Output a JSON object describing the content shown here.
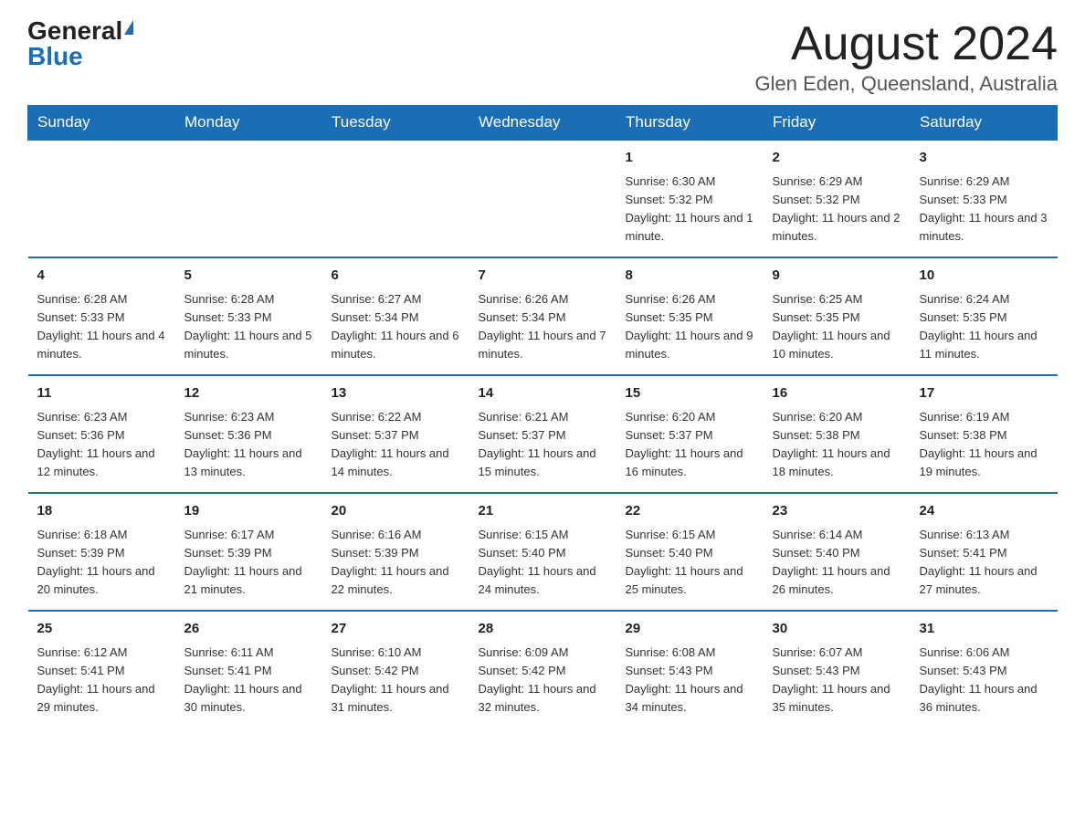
{
  "header": {
    "logo_general": "General",
    "logo_blue": "Blue",
    "month_title": "August 2024",
    "location": "Glen Eden, Queensland, Australia"
  },
  "weekdays": [
    "Sunday",
    "Monday",
    "Tuesday",
    "Wednesday",
    "Thursday",
    "Friday",
    "Saturday"
  ],
  "weeks": [
    [
      {
        "day": "",
        "info": ""
      },
      {
        "day": "",
        "info": ""
      },
      {
        "day": "",
        "info": ""
      },
      {
        "day": "",
        "info": ""
      },
      {
        "day": "1",
        "info": "Sunrise: 6:30 AM\nSunset: 5:32 PM\nDaylight: 11 hours and 1 minute."
      },
      {
        "day": "2",
        "info": "Sunrise: 6:29 AM\nSunset: 5:32 PM\nDaylight: 11 hours and 2 minutes."
      },
      {
        "day": "3",
        "info": "Sunrise: 6:29 AM\nSunset: 5:33 PM\nDaylight: 11 hours and 3 minutes."
      }
    ],
    [
      {
        "day": "4",
        "info": "Sunrise: 6:28 AM\nSunset: 5:33 PM\nDaylight: 11 hours and 4 minutes."
      },
      {
        "day": "5",
        "info": "Sunrise: 6:28 AM\nSunset: 5:33 PM\nDaylight: 11 hours and 5 minutes."
      },
      {
        "day": "6",
        "info": "Sunrise: 6:27 AM\nSunset: 5:34 PM\nDaylight: 11 hours and 6 minutes."
      },
      {
        "day": "7",
        "info": "Sunrise: 6:26 AM\nSunset: 5:34 PM\nDaylight: 11 hours and 7 minutes."
      },
      {
        "day": "8",
        "info": "Sunrise: 6:26 AM\nSunset: 5:35 PM\nDaylight: 11 hours and 9 minutes."
      },
      {
        "day": "9",
        "info": "Sunrise: 6:25 AM\nSunset: 5:35 PM\nDaylight: 11 hours and 10 minutes."
      },
      {
        "day": "10",
        "info": "Sunrise: 6:24 AM\nSunset: 5:35 PM\nDaylight: 11 hours and 11 minutes."
      }
    ],
    [
      {
        "day": "11",
        "info": "Sunrise: 6:23 AM\nSunset: 5:36 PM\nDaylight: 11 hours and 12 minutes."
      },
      {
        "day": "12",
        "info": "Sunrise: 6:23 AM\nSunset: 5:36 PM\nDaylight: 11 hours and 13 minutes."
      },
      {
        "day": "13",
        "info": "Sunrise: 6:22 AM\nSunset: 5:37 PM\nDaylight: 11 hours and 14 minutes."
      },
      {
        "day": "14",
        "info": "Sunrise: 6:21 AM\nSunset: 5:37 PM\nDaylight: 11 hours and 15 minutes."
      },
      {
        "day": "15",
        "info": "Sunrise: 6:20 AM\nSunset: 5:37 PM\nDaylight: 11 hours and 16 minutes."
      },
      {
        "day": "16",
        "info": "Sunrise: 6:20 AM\nSunset: 5:38 PM\nDaylight: 11 hours and 18 minutes."
      },
      {
        "day": "17",
        "info": "Sunrise: 6:19 AM\nSunset: 5:38 PM\nDaylight: 11 hours and 19 minutes."
      }
    ],
    [
      {
        "day": "18",
        "info": "Sunrise: 6:18 AM\nSunset: 5:39 PM\nDaylight: 11 hours and 20 minutes."
      },
      {
        "day": "19",
        "info": "Sunrise: 6:17 AM\nSunset: 5:39 PM\nDaylight: 11 hours and 21 minutes."
      },
      {
        "day": "20",
        "info": "Sunrise: 6:16 AM\nSunset: 5:39 PM\nDaylight: 11 hours and 22 minutes."
      },
      {
        "day": "21",
        "info": "Sunrise: 6:15 AM\nSunset: 5:40 PM\nDaylight: 11 hours and 24 minutes."
      },
      {
        "day": "22",
        "info": "Sunrise: 6:15 AM\nSunset: 5:40 PM\nDaylight: 11 hours and 25 minutes."
      },
      {
        "day": "23",
        "info": "Sunrise: 6:14 AM\nSunset: 5:40 PM\nDaylight: 11 hours and 26 minutes."
      },
      {
        "day": "24",
        "info": "Sunrise: 6:13 AM\nSunset: 5:41 PM\nDaylight: 11 hours and 27 minutes."
      }
    ],
    [
      {
        "day": "25",
        "info": "Sunrise: 6:12 AM\nSunset: 5:41 PM\nDaylight: 11 hours and 29 minutes."
      },
      {
        "day": "26",
        "info": "Sunrise: 6:11 AM\nSunset: 5:41 PM\nDaylight: 11 hours and 30 minutes."
      },
      {
        "day": "27",
        "info": "Sunrise: 6:10 AM\nSunset: 5:42 PM\nDaylight: 11 hours and 31 minutes."
      },
      {
        "day": "28",
        "info": "Sunrise: 6:09 AM\nSunset: 5:42 PM\nDaylight: 11 hours and 32 minutes."
      },
      {
        "day": "29",
        "info": "Sunrise: 6:08 AM\nSunset: 5:43 PM\nDaylight: 11 hours and 34 minutes."
      },
      {
        "day": "30",
        "info": "Sunrise: 6:07 AM\nSunset: 5:43 PM\nDaylight: 11 hours and 35 minutes."
      },
      {
        "day": "31",
        "info": "Sunrise: 6:06 AM\nSunset: 5:43 PM\nDaylight: 11 hours and 36 minutes."
      }
    ]
  ]
}
